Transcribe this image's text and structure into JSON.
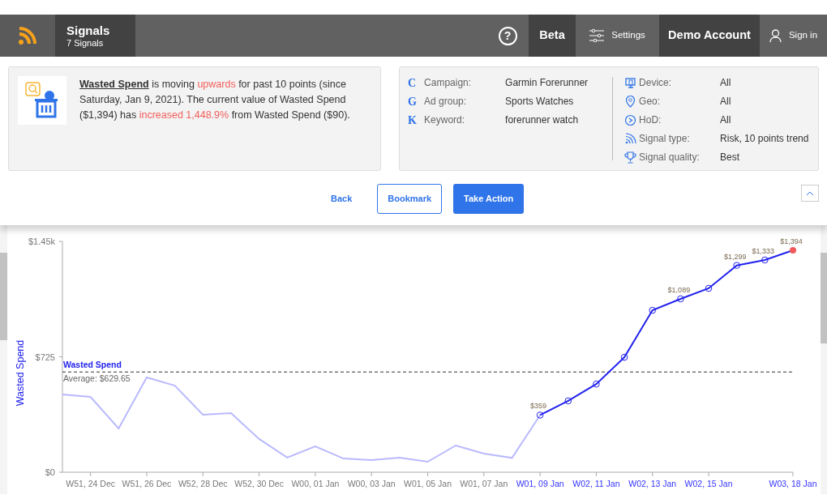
{
  "header": {
    "title": "Signals",
    "subtitle": "7 Signals",
    "help_icon_text": "?",
    "items": [
      {
        "label": "Beta",
        "kind": "dark"
      },
      {
        "label": "Settings",
        "kind": "settings"
      },
      {
        "label": "Demo Account",
        "kind": "dark"
      },
      {
        "label": "Sign in",
        "kind": "user"
      }
    ]
  },
  "signal": {
    "description": [
      {
        "text": "Wasted Spend",
        "kind": "metric"
      },
      {
        "text": " is moving ",
        "kind": "plain"
      },
      {
        "text": "upwards",
        "kind": "highlight"
      },
      {
        "text": " for past 10 points (since Saturday, Jan 9, 2021). The current value of Wasted Spend ($1,394) has ",
        "kind": "plain"
      },
      {
        "text": "increased 1,448.9%",
        "kind": "highlight"
      },
      {
        "text": " from Wasted Spend ($90).",
        "kind": "plain"
      }
    ]
  },
  "details_left": [
    {
      "letter": "C",
      "label": "Campaign:",
      "value": "Garmin Forerunner"
    },
    {
      "letter": "G",
      "label": "Ad group:",
      "value": "Sports Watches"
    },
    {
      "letter": "K",
      "label": "Keyword:",
      "value": "forerunner watch"
    }
  ],
  "details_right": [
    {
      "kind": "device",
      "label": "Device:",
      "value": "All"
    },
    {
      "kind": "geo",
      "label": "Geo:",
      "value": "All"
    },
    {
      "kind": "clock",
      "label": "HoD:",
      "value": "All"
    },
    {
      "kind": "signal",
      "label": "Signal type:",
      "value": "Risk, 10 points trend"
    },
    {
      "kind": "trophy",
      "label": "Signal quality:",
      "value": "Best"
    }
  ],
  "actions": [
    {
      "label": "Back",
      "kind": "link"
    },
    {
      "label": "Bookmark",
      "kind": "outline"
    },
    {
      "label": "Take Action",
      "kind": "primary"
    }
  ],
  "chart_data": {
    "type": "line",
    "ylabel": "Wasted Spend",
    "ylim": [
      0,
      1450
    ],
    "yticks": [
      {
        "value": 0,
        "label": "$0"
      },
      {
        "value": 725,
        "label": "$725"
      },
      {
        "value": 1450,
        "label": "$1.45k"
      }
    ],
    "categories": [
      null,
      "W51, 24 Dec",
      null,
      "W51, 26 Dec",
      null,
      "W52, 28 Dec",
      null,
      "W52, 30 Dec",
      null,
      "W00, 01 Jan",
      null,
      "W00, 03 Jan",
      null,
      "W01, 05 Jan",
      null,
      "W01, 07 Jan",
      null,
      "W01, 09 Jan",
      null,
      "W02, 11 Jan",
      null,
      "W02, 13 Jan",
      null,
      "W02, 15 Jan",
      null,
      null,
      "W03, 18 Jan"
    ],
    "series": [
      {
        "color": "#b9b9ff",
        "values": [
          488,
          473,
          275,
          595,
          544,
          361,
          371,
          209,
          92,
          163,
          86,
          76,
          92,
          66,
          168,
          117,
          90,
          359,
          null,
          null,
          null,
          null,
          null,
          null,
          null,
          null,
          null
        ]
      },
      {
        "name": "Wasted Spend",
        "color": "#2222ee",
        "marker": "circle",
        "values": [
          null,
          null,
          null,
          null,
          null,
          null,
          null,
          null,
          null,
          null,
          null,
          null,
          null,
          null,
          null,
          null,
          null,
          359,
          448,
          554,
          722,
          1017,
          1089,
          1155,
          1299,
          1333,
          1394
        ]
      }
    ],
    "value_labels": [
      null,
      null,
      null,
      null,
      null,
      null,
      null,
      null,
      null,
      null,
      null,
      null,
      null,
      null,
      null,
      null,
      null,
      "$359",
      null,
      null,
      null,
      null,
      "$1,089",
      null,
      "$1,299",
      "$1,333",
      "$1,394"
    ],
    "ref_lines": [
      {
        "axis": "y",
        "value": 629.65,
        "label": "Average: $629.65"
      }
    ]
  }
}
